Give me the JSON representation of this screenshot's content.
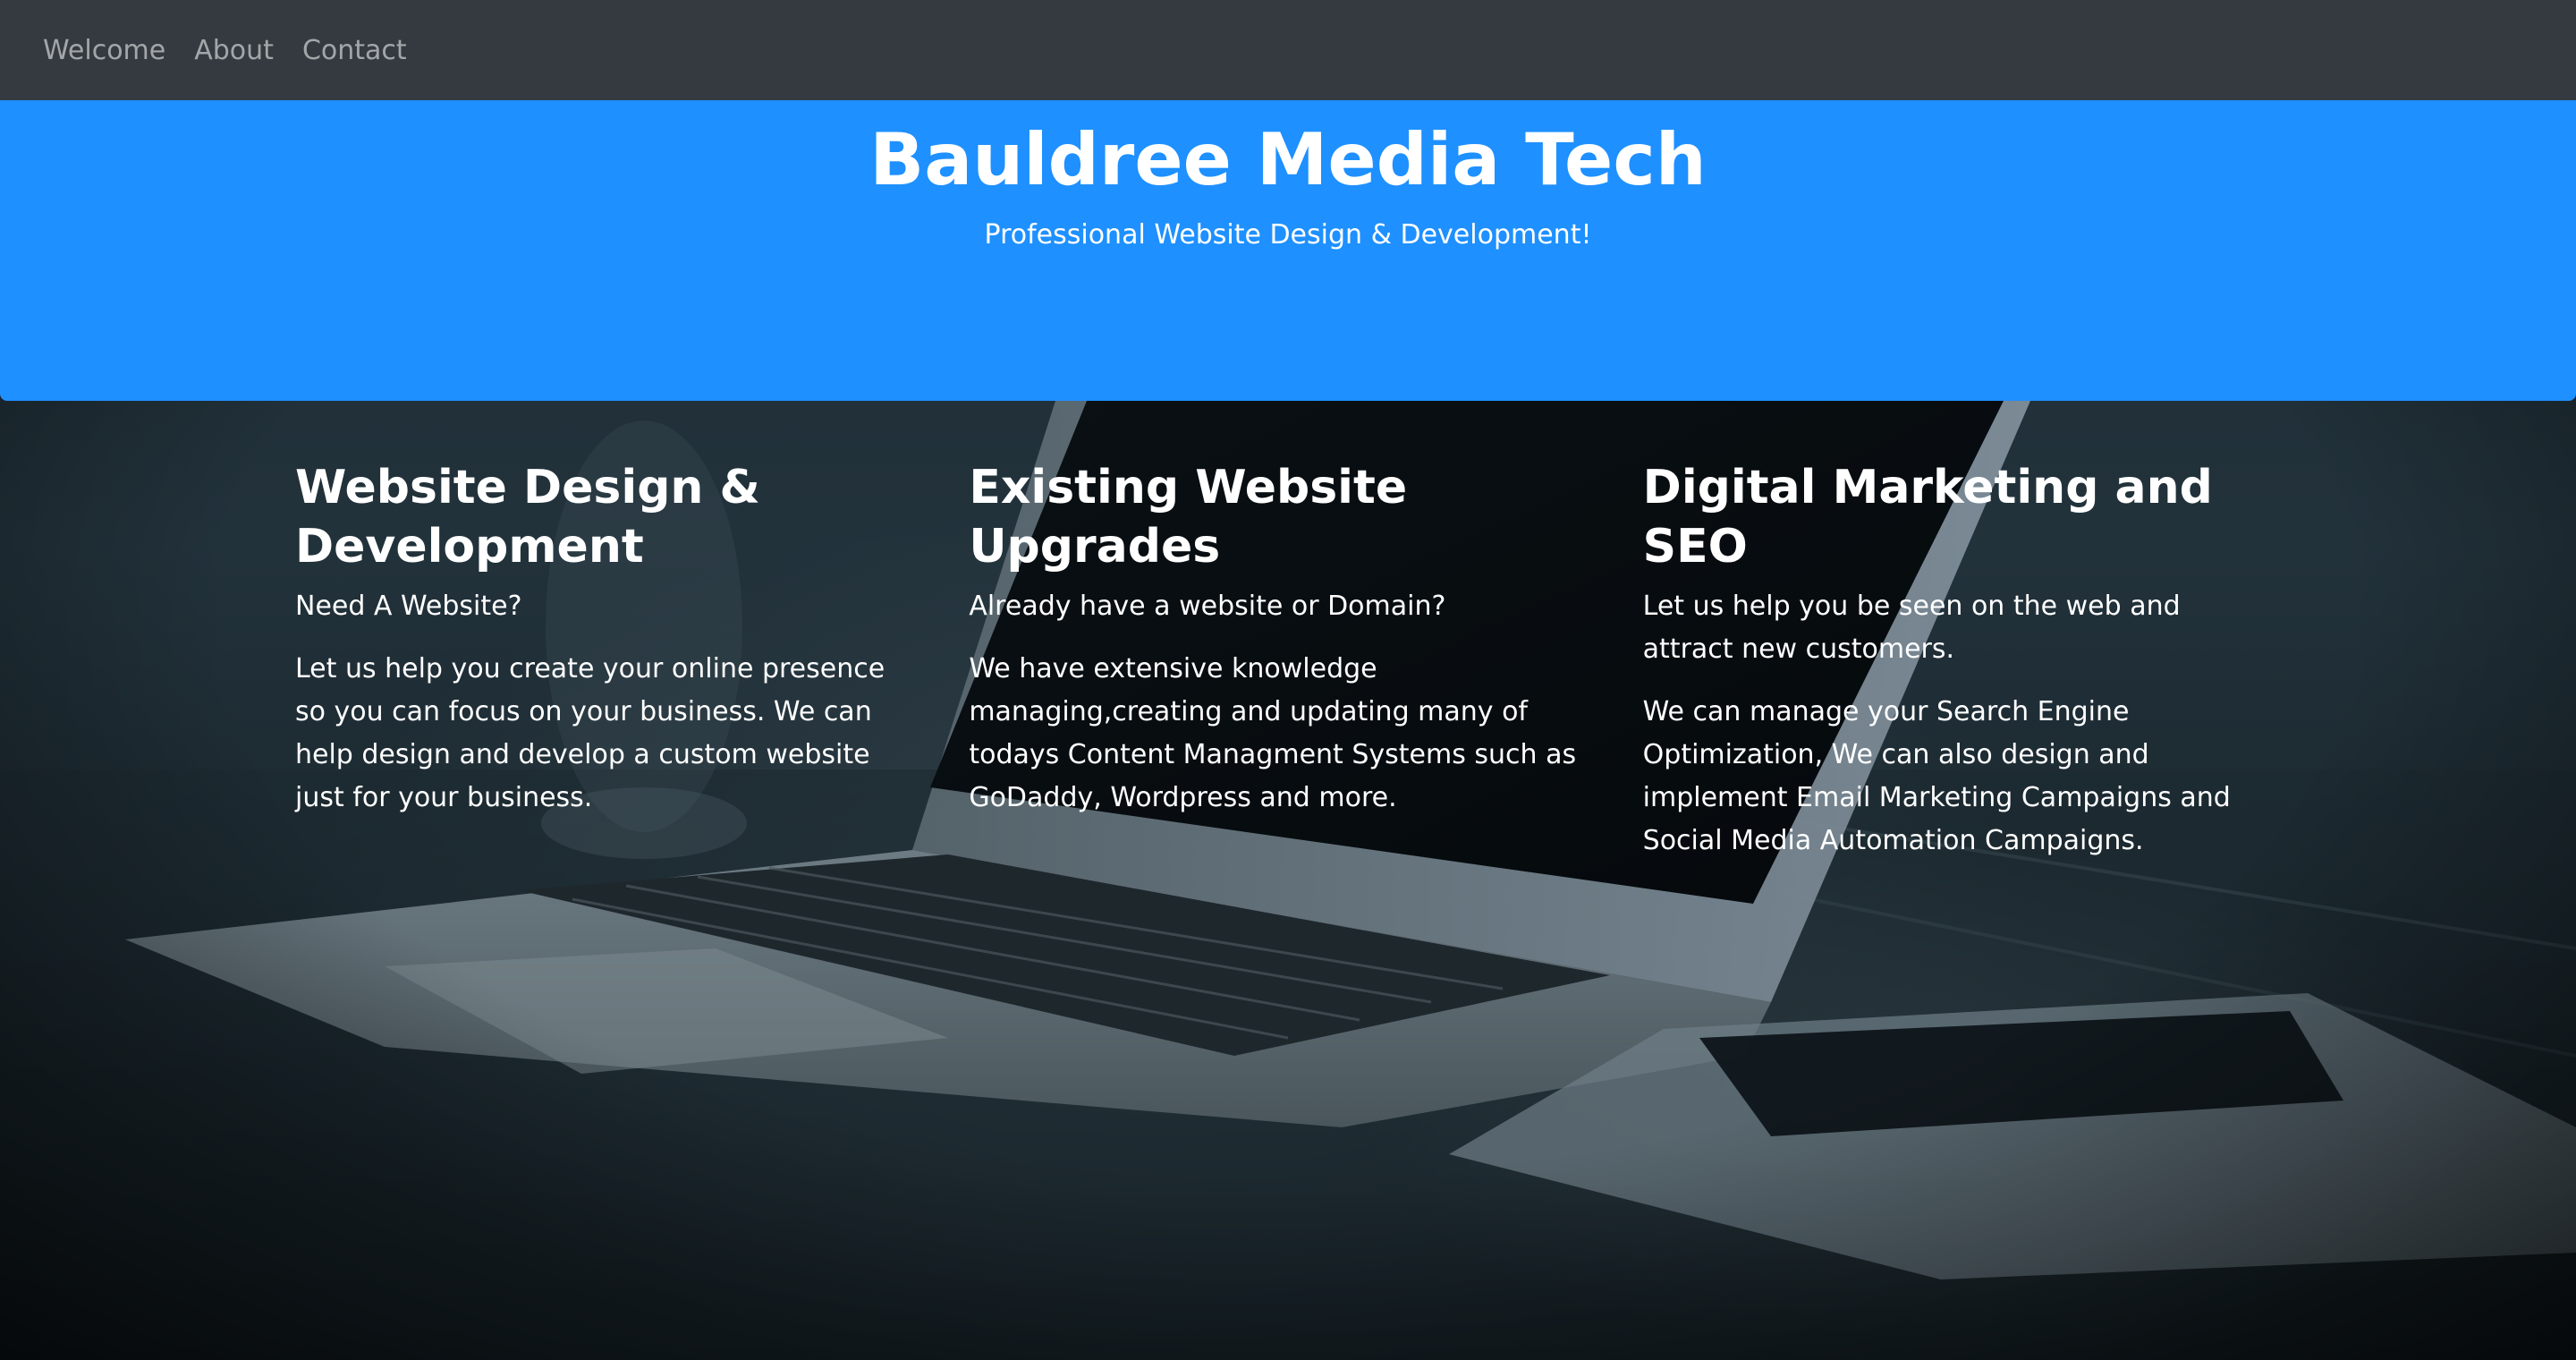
{
  "nav": {
    "items": [
      {
        "label": "Welcome"
      },
      {
        "label": "About"
      },
      {
        "label": "Contact"
      }
    ]
  },
  "jumbotron": {
    "title": "Bauldree Media Tech",
    "subtitle": "Professional Website Design & Development!",
    "background_color": "#1e90ff"
  },
  "services": [
    {
      "title": "Website Design & Development",
      "lead": "Need A Website?",
      "body": "Let us help you create your online presence so you can focus on your business. We can help design and develop a custom website just for your business."
    },
    {
      "title": "Existing Website Upgrades",
      "lead": "Already have a website or Domain?",
      "body": "We have extensive knowledge managing,creating and updating many of todays Content Managment Systems such as GoDaddy, Wordpress and more."
    },
    {
      "title": "Digital Marketing and SEO",
      "lead": "Let us help you be seen on the web and attract new customers.",
      "body": "We can manage your Search Engine Optimization, We can also design and implement Email Marketing Campaigns and Social Media Automation Campaigns."
    }
  ],
  "colors": {
    "navbar": "#343a40",
    "nav_link": "rgba(255,255,255,0.55)",
    "accent": "#1e90ff",
    "text": "#ffffff"
  }
}
